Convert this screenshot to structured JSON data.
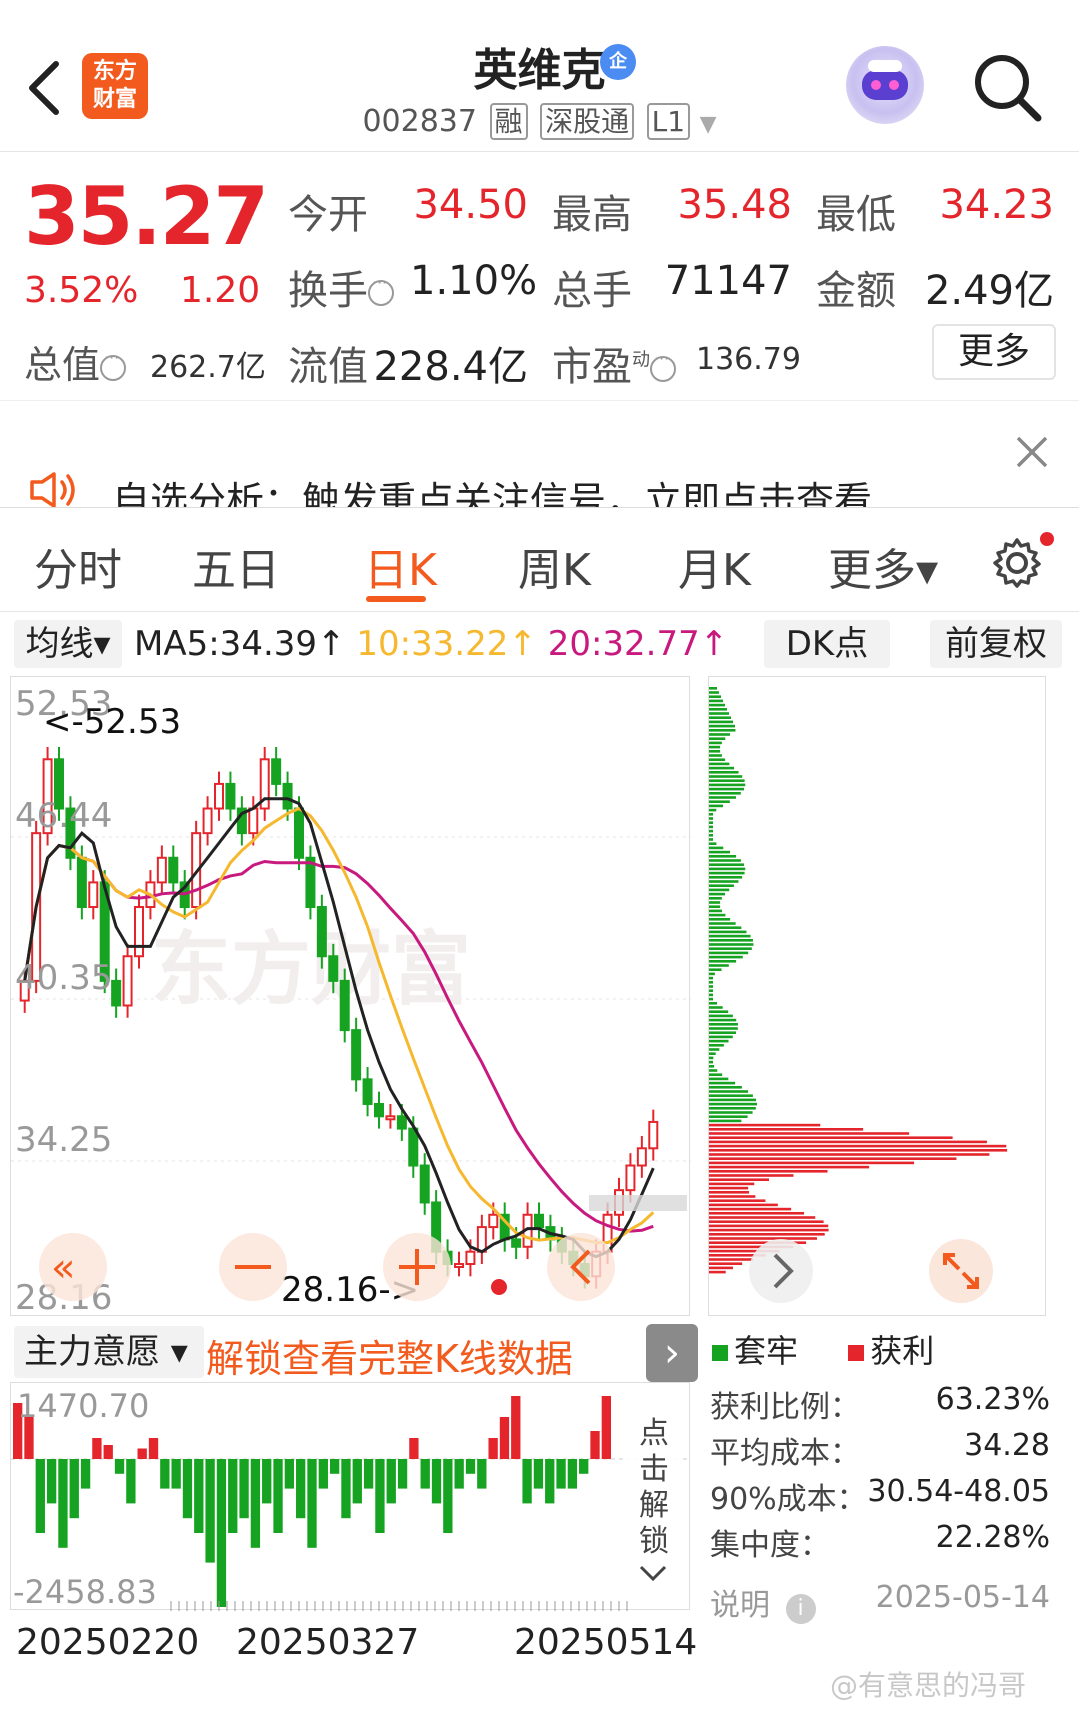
{
  "header": {
    "app_logo_line1": "东方",
    "app_logo_line2": "财富",
    "stock_name": "英维克",
    "enterprise_badge": "企",
    "stock_code": "002837",
    "tags": [
      "融",
      "深股通",
      "L1"
    ]
  },
  "quote": {
    "price": "35.27",
    "change_pct": "3.52%",
    "change": "1.20",
    "open_label": "今开",
    "open": "34.50",
    "high_label": "最高",
    "high": "35.48",
    "low_label": "最低",
    "low": "34.23",
    "turnover_label": "换手",
    "turnover": "1.10%",
    "volume_label": "总手",
    "volume": "71147",
    "amount_label": "金额",
    "amount": "2.49亿",
    "mktcap_label": "总值",
    "mktcap": "262.7亿",
    "float_label": "流值",
    "float": "228.4亿",
    "pe_label": "市盈",
    "pe_sup": "动",
    "pe": "136.79",
    "more_label": "更多"
  },
  "notice": {
    "text": "自选分析：触发重点关注信号，立即点击查看"
  },
  "tabs": {
    "items": [
      "分时",
      "五日",
      "日K",
      "周K",
      "月K",
      "更多▾"
    ],
    "active": "日K"
  },
  "ma_row": {
    "dropdown": "均线▾",
    "ma5": "MA5:34.39↑",
    "ma10": "10:33.22↑",
    "ma20": "20:32.77↑",
    "dk_label": "DK点",
    "fq_label": "前复权",
    "colors": {
      "ma5": "#222222",
      "ma10": "#f5b82e",
      "ma20": "#c8197f"
    }
  },
  "kline": {
    "y_ticks": [
      "52.53",
      "46.44",
      "40.35",
      "34.25",
      "28.16"
    ],
    "high_marker": "<-52.53",
    "low_marker": "28.16->",
    "watermark": "东方财富",
    "up_color": "#e4262c",
    "down_color": "#16a321"
  },
  "chip": {
    "legend_loss": "套牢",
    "legend_profit": "获利",
    "stats": [
      {
        "label": "获利比例：",
        "value": "63.23%"
      },
      {
        "label": "平均成本：",
        "value": "34.28"
      },
      {
        "label": "90%成本：",
        "value": "30.54-48.05"
      },
      {
        "label": "集中度：",
        "value": "22.28%"
      }
    ],
    "note_label": "说明",
    "date": "2025-05-14"
  },
  "indicator": {
    "dropdown": "主力意愿 ▾",
    "unlock_text": "解锁查看完整K线数据",
    "arrow": "›",
    "y_top": "1470.70",
    "y_bottom": "-2458.83",
    "side_lock": "点击解锁"
  },
  "dates": [
    "20250220",
    "20250327",
    "20250514"
  ],
  "footer_watermark": "@有意思的冯哥"
}
